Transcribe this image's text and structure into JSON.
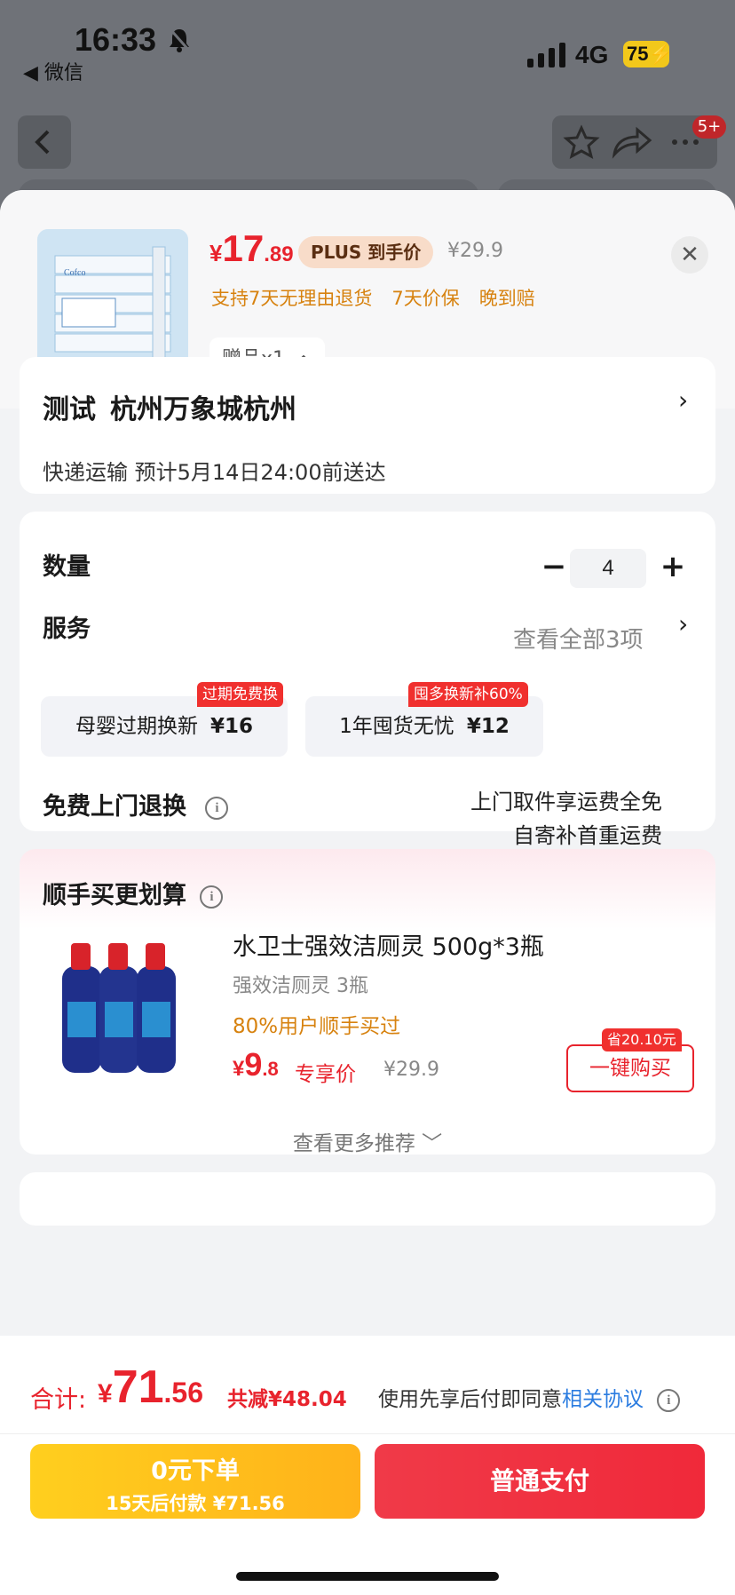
{
  "status_bar": {
    "time": "16:33",
    "back_app": "◀ 微信",
    "network": "4G",
    "battery": "75"
  },
  "background": {
    "badge": "5+"
  },
  "product": {
    "price_currency": "¥",
    "price_int": "17",
    "price_dec": ".89",
    "plus_tag": "PLUS 到手价",
    "original_price": "¥29.9",
    "promises": [
      "支持7天无理由退货",
      "7天价保",
      "晚到赔"
    ],
    "gift_label": "赠品x1",
    "close_symbol": "✕"
  },
  "address": {
    "name": "测试",
    "place": "杭州万象城杭州",
    "delivery": "快递运输 预计5月14日24:00前送达"
  },
  "quantity": {
    "label": "数量",
    "value": "4",
    "minus": "−",
    "plus": "+"
  },
  "service": {
    "label": "服务",
    "view_all": "查看全部3项",
    "options": [
      {
        "name": "母婴过期换新",
        "price": "¥16",
        "tag": "过期免费换"
      },
      {
        "name": "1年囤货无忧",
        "price": "¥12",
        "tag": "囤多换新补60%"
      }
    ]
  },
  "return_service": {
    "label": "免费上门退换",
    "info_icon": "i",
    "desc_line1": "上门取件享运费全免",
    "desc_line2": "自寄补首重运费"
  },
  "recommend": {
    "title": "顺手买更划算",
    "item": {
      "name": "水卫士强效洁厕灵 500g*3瓶",
      "sub": "强效洁厕灵 3瓶",
      "popularity": "80%用户顺手买过",
      "price_currency": "¥",
      "price_int": "9",
      "price_dec": ".8",
      "exclusive": "专享价",
      "original_price": "¥29.9",
      "save_tag": "省20.10元",
      "buy_label": "一键购买"
    },
    "more": "查看更多推荐 ﹀"
  },
  "checkout": {
    "total_label": "合计:",
    "total_currency": "¥",
    "total_int": "71",
    "total_dec": ".56",
    "total_save": "共减¥48.04",
    "agree_text": "使用先享后付即同意",
    "agree_link": "相关协议",
    "later_line1": "0元下单",
    "later_line2": "15天后付款 ¥71.56",
    "pay_label": "普通支付"
  }
}
